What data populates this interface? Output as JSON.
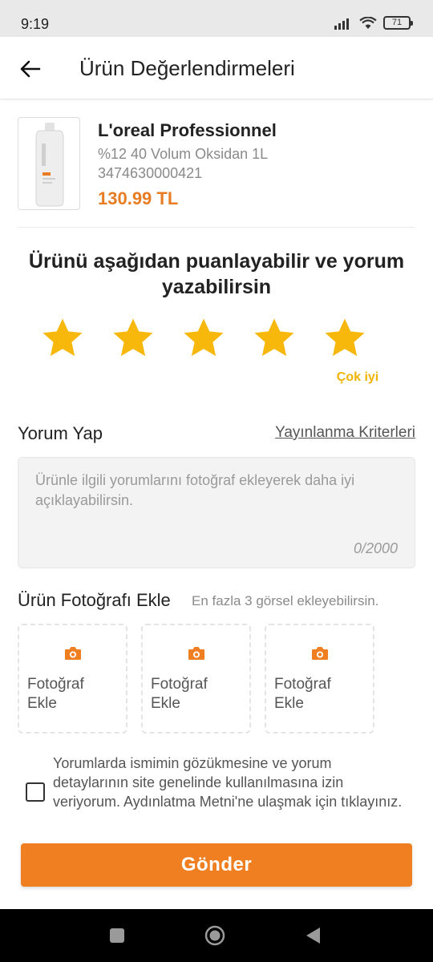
{
  "status_bar": {
    "time": "9:19",
    "battery": "71"
  },
  "header": {
    "title": "Ürün Değerlendirmeleri"
  },
  "product": {
    "brand": "L'oreal Professionnel",
    "name": "%12 40 Volum Oksidan 1L",
    "code": "3474630000421",
    "price": "130.99 TL",
    "image_label": "OXYDANT"
  },
  "rating": {
    "prompt": "Ürünü aşağıdan puanlayabilir ve yorum yazabilirsin",
    "stars_max": 5,
    "stars_selected": 5,
    "selected_label": "Çok iyi",
    "star_color": "#f7b80b"
  },
  "comment": {
    "title": "Yorum Yap",
    "criteria_link": "Yayınlanma Kriterleri",
    "placeholder": "Ürünle ilgili yorumlarını fotoğraf ekleyerek daha iyi açıklayabilirsin.",
    "counter": "0/2000"
  },
  "photos": {
    "title": "Ürün Fotoğrafı Ekle",
    "hint": "En fazla 3 görsel ekleyebilirsin.",
    "slots": [
      {
        "label": "Fotoğraf Ekle",
        "icon": "camera-icon"
      },
      {
        "label": "Fotoğraf Ekle",
        "icon": "camera-icon"
      },
      {
        "label": "Fotoğraf Ekle",
        "icon": "camera-icon"
      }
    ]
  },
  "consent": {
    "checked": false,
    "text": "Yorumlarda ismimin gözükmesine ve yorum detaylarının site genelinde kullanılmasına izin veriyorum. Aydınlatma Metni'ne ulaşmak için tıklayınız."
  },
  "submit": {
    "label": "Gönder"
  },
  "colors": {
    "accent": "#f07f22",
    "price": "#e87c23",
    "star": "#f7b80b"
  },
  "nav": {
    "icons": [
      "recents-icon",
      "home-icon",
      "back-icon"
    ]
  }
}
